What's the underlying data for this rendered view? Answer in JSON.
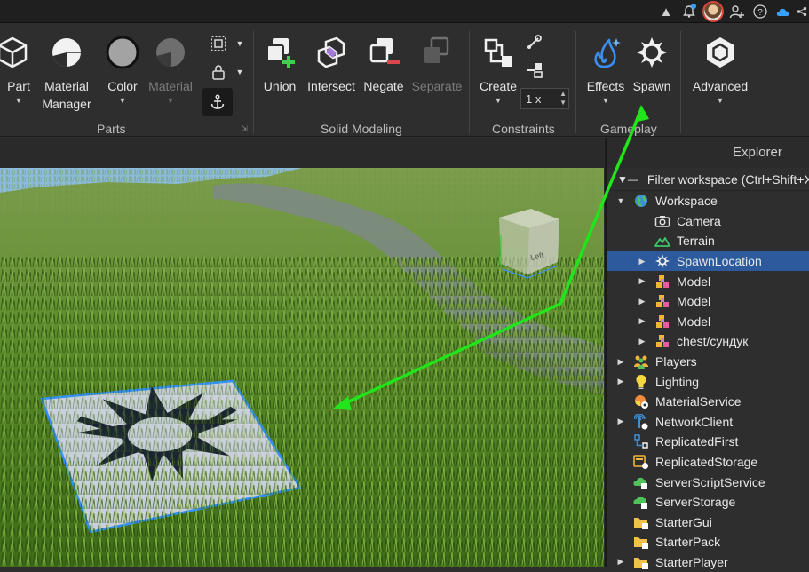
{
  "topbar": {
    "icons": [
      "chevron-up-icon",
      "bell-icon",
      "avatar",
      "add-friend-icon",
      "help-icon",
      "cloud-icon",
      "share-icon"
    ]
  },
  "ribbon": {
    "parts_group": {
      "label": "Parts",
      "part": "Part",
      "material_manager": "Material\nManager",
      "color": "Color",
      "material": "Material"
    },
    "solid_modeling_group": {
      "label": "Solid Modeling",
      "union": "Union",
      "intersect": "Intersect",
      "negate": "Negate",
      "separate": "Separate"
    },
    "constraints_group": {
      "label": "Constraints",
      "create": "Create",
      "scale_value": "1 x"
    },
    "gameplay_group": {
      "label": "Gameplay",
      "effects": "Effects",
      "spawn": "Spawn"
    },
    "advanced": "Advanced"
  },
  "explorer": {
    "title": "Explorer",
    "filter_placeholder": "Filter workspace (Ctrl+Shift+X)",
    "items": [
      {
        "label": "Workspace",
        "depth": 0,
        "arrow": "down",
        "icon": "globe-icon"
      },
      {
        "label": "Camera",
        "depth": 1,
        "arrow": "",
        "icon": "camera-icon"
      },
      {
        "label": "Terrain",
        "depth": 1,
        "arrow": "",
        "icon": "terrain-icon"
      },
      {
        "label": "SpawnLocation",
        "depth": 1,
        "arrow": "right",
        "icon": "spawn-icon",
        "selected": true
      },
      {
        "label": "Model",
        "depth": 1,
        "arrow": "right",
        "icon": "model-icon"
      },
      {
        "label": "Model",
        "depth": 1,
        "arrow": "right",
        "icon": "model-icon"
      },
      {
        "label": "Model",
        "depth": 1,
        "arrow": "right",
        "icon": "model-icon"
      },
      {
        "label": "chest/сундук",
        "depth": 1,
        "arrow": "right",
        "icon": "model-icon"
      },
      {
        "label": "Players",
        "depth": 0,
        "arrow": "right",
        "icon": "players-icon"
      },
      {
        "label": "Lighting",
        "depth": 0,
        "arrow": "right",
        "icon": "lightbulb-icon"
      },
      {
        "label": "MaterialService",
        "depth": 0,
        "arrow": "",
        "icon": "material-service-icon"
      },
      {
        "label": "NetworkClient",
        "depth": 0,
        "arrow": "right",
        "icon": "network-icon"
      },
      {
        "label": "ReplicatedFirst",
        "depth": 0,
        "arrow": "",
        "icon": "replicated-first-icon"
      },
      {
        "label": "ReplicatedStorage",
        "depth": 0,
        "arrow": "",
        "icon": "replicated-storage-icon"
      },
      {
        "label": "ServerScriptService",
        "depth": 0,
        "arrow": "",
        "icon": "server-script-icon"
      },
      {
        "label": "ServerStorage",
        "depth": 0,
        "arrow": "",
        "icon": "server-storage-icon"
      },
      {
        "label": "StarterGui",
        "depth": 0,
        "arrow": "",
        "icon": "folder-icon"
      },
      {
        "label": "StarterPack",
        "depth": 0,
        "arrow": "",
        "icon": "folder-icon"
      },
      {
        "label": "StarterPlayer",
        "depth": 0,
        "arrow": "right",
        "icon": "folder-icon"
      }
    ]
  },
  "viewport": {
    "dice_text": "Left"
  },
  "colors": {
    "accent": "#2c5a9c",
    "annotation_arrow": "#22e41a",
    "selection_outline": "#2f8fff"
  }
}
